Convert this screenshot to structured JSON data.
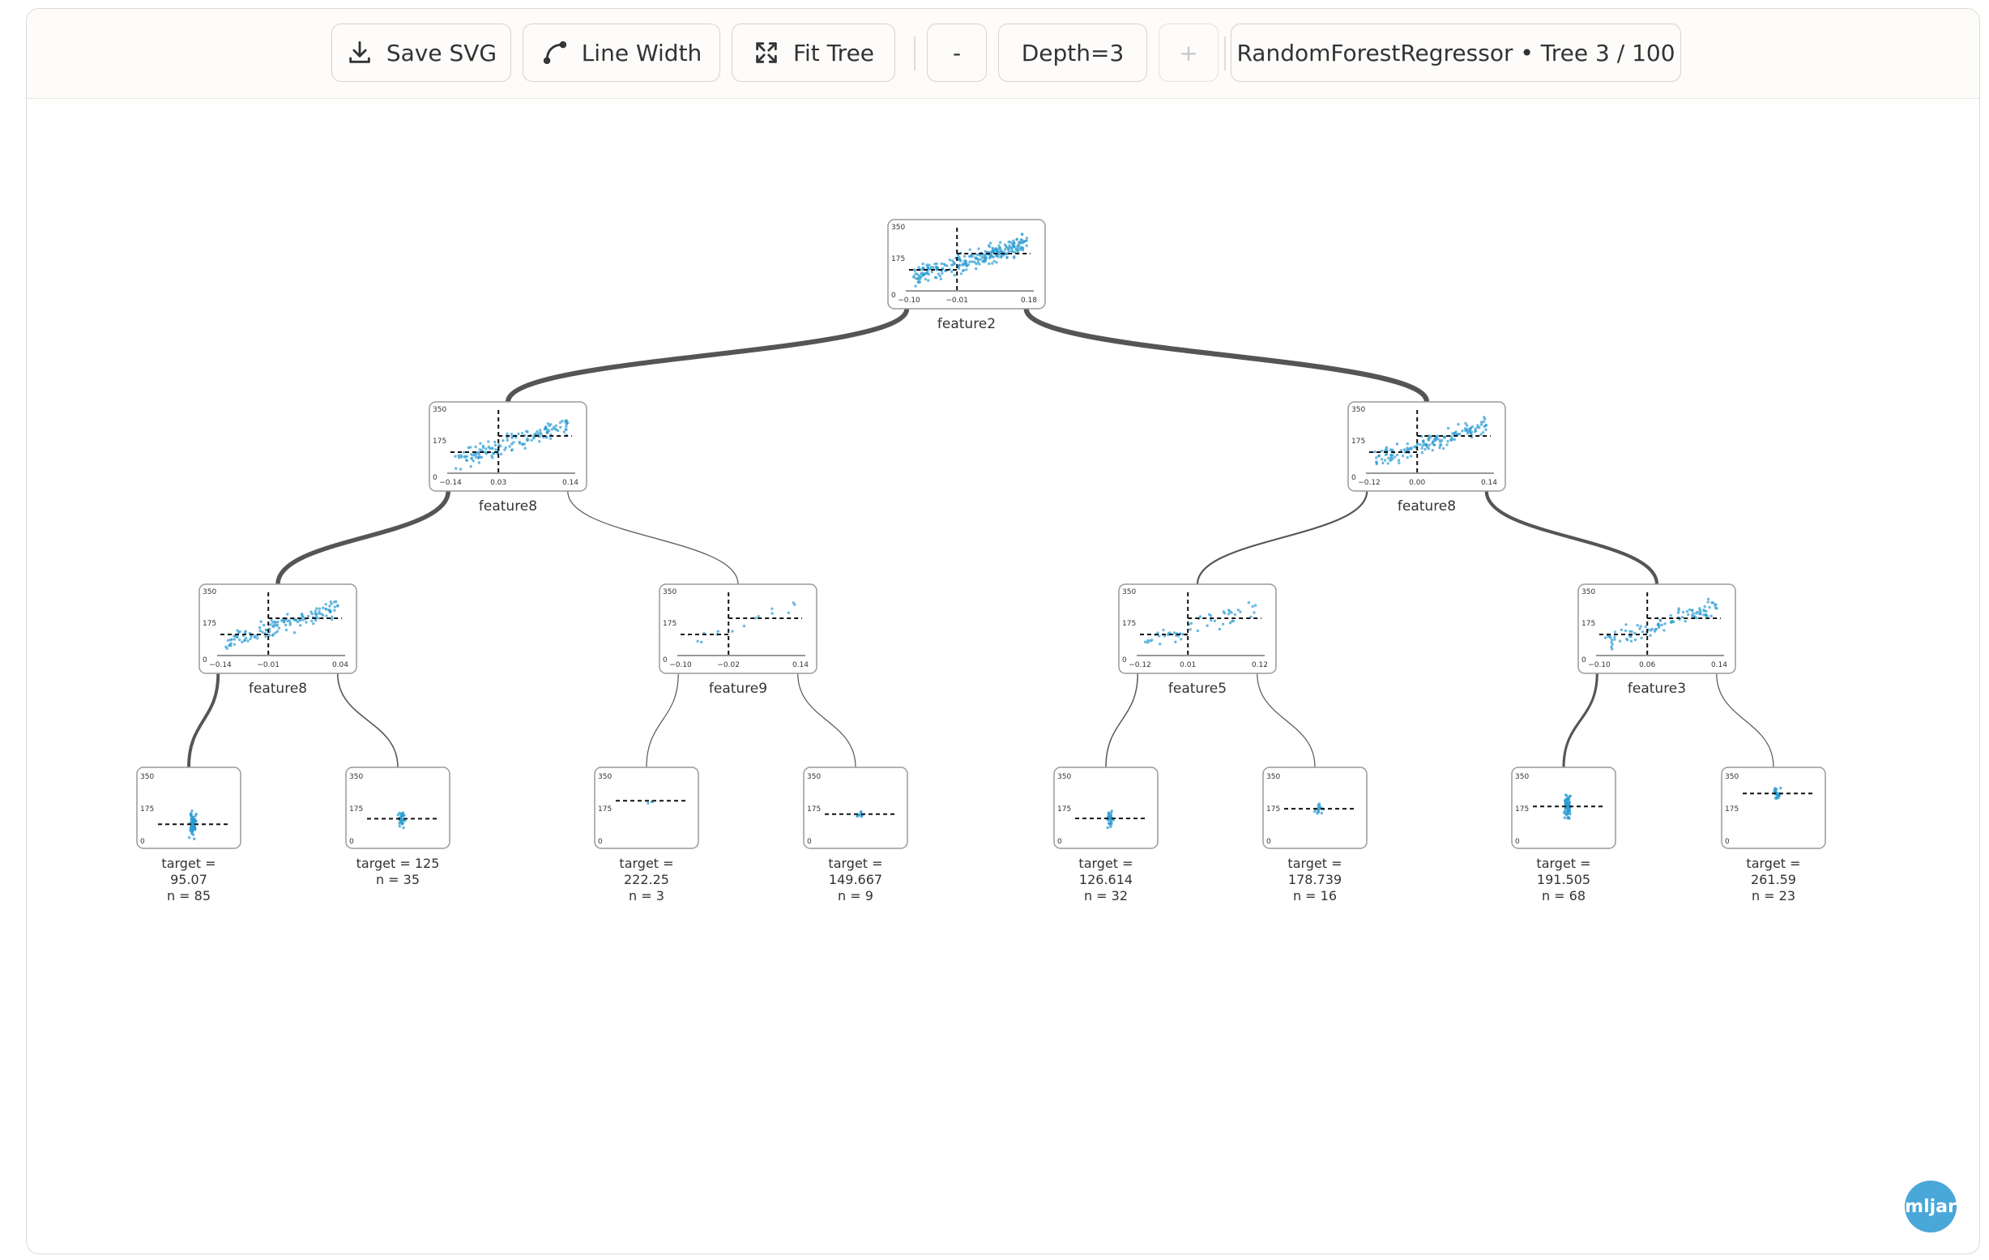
{
  "toolbar": {
    "save_label": "Save SVG",
    "line_width_label": "Line Width",
    "fit_label": "Fit Tree",
    "minus_label": "-",
    "depth_label": "Depth=3",
    "plus_label": "+",
    "model_label": "RandomForestRegressor • Tree 3 / 100"
  },
  "brand": {
    "logo_text": "mljar"
  },
  "colors": {
    "point": "#2b9bd1",
    "edge": "#555555",
    "border": "#9a9a9a"
  },
  "tree": {
    "y_ticks": [
      "0",
      "175",
      "350"
    ],
    "splits": [
      {
        "id": "n0",
        "feature": "feature2",
        "xticks": [
          "−0.10",
          "−0.01",
          "0.18"
        ],
        "children": [
          "n1",
          "n2"
        ]
      },
      {
        "id": "n1",
        "feature": "feature8",
        "xticks": [
          "−0.14",
          "0.03",
          "0.14"
        ],
        "children": [
          "n3",
          "n4"
        ]
      },
      {
        "id": "n2",
        "feature": "feature8",
        "xticks": [
          "−0.12",
          "0.00",
          "0.14"
        ],
        "children": [
          "n5",
          "n6"
        ]
      },
      {
        "id": "n3",
        "feature": "feature8",
        "xticks": [
          "−0.14",
          "−0.01",
          "0.04"
        ],
        "children": [
          "l0",
          "l1"
        ]
      },
      {
        "id": "n4",
        "feature": "feature9",
        "xticks": [
          "−0.10",
          "−0.02",
          "0.14"
        ],
        "children": [
          "l2",
          "l3"
        ]
      },
      {
        "id": "n5",
        "feature": "feature5",
        "xticks": [
          "−0.12",
          "0.01",
          "0.12"
        ],
        "children": [
          "l4",
          "l5"
        ]
      },
      {
        "id": "n6",
        "feature": "feature3",
        "xticks": [
          "−0.10",
          "0.06",
          "0.14"
        ],
        "children": [
          "l6",
          "l7"
        ]
      }
    ],
    "leaves": [
      {
        "id": "l0",
        "target": "95.07",
        "n": 85
      },
      {
        "id": "l1",
        "target": "125",
        "n": 35
      },
      {
        "id": "l2",
        "target": "222.25",
        "n": 3
      },
      {
        "id": "l3",
        "target": "149.667",
        "n": 9
      },
      {
        "id": "l4",
        "target": "126.614",
        "n": 32
      },
      {
        "id": "l5",
        "target": "178.739",
        "n": 16
      },
      {
        "id": "l6",
        "target": "191.505",
        "n": 68
      },
      {
        "id": "l7",
        "target": "261.59",
        "n": 23
      }
    ]
  }
}
